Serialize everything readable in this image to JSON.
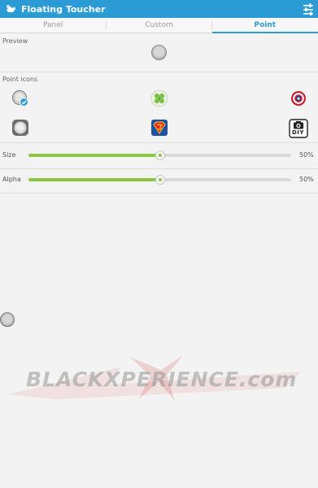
{
  "app": {
    "title": "Floating Toucher"
  },
  "tabs": [
    {
      "label": "Panel"
    },
    {
      "label": "Custom"
    },
    {
      "label": "Point"
    }
  ],
  "preview": {
    "label": "Preview"
  },
  "point_icons": {
    "label": "Point icons",
    "items": [
      {
        "icon": "gray-ball-checked-icon",
        "selected": true
      },
      {
        "icon": "green-clover-icon"
      },
      {
        "icon": "captain-shield-icon"
      },
      {
        "icon": "gray-rounded-square-icon"
      },
      {
        "icon": "superman-logo-icon"
      },
      {
        "icon": "diy-camera-icon",
        "text": "DIY"
      }
    ]
  },
  "sliders": {
    "size": {
      "label": "Size",
      "value_text": "50%",
      "value": 0.5
    },
    "alpha": {
      "label": "Alpha",
      "value_text": "50%",
      "value": 0.5
    }
  },
  "colors": {
    "accent": "#2a9bd4",
    "slider": "#8dc63f"
  },
  "watermark": {
    "text": "BLACKXPERIENCE.com"
  }
}
